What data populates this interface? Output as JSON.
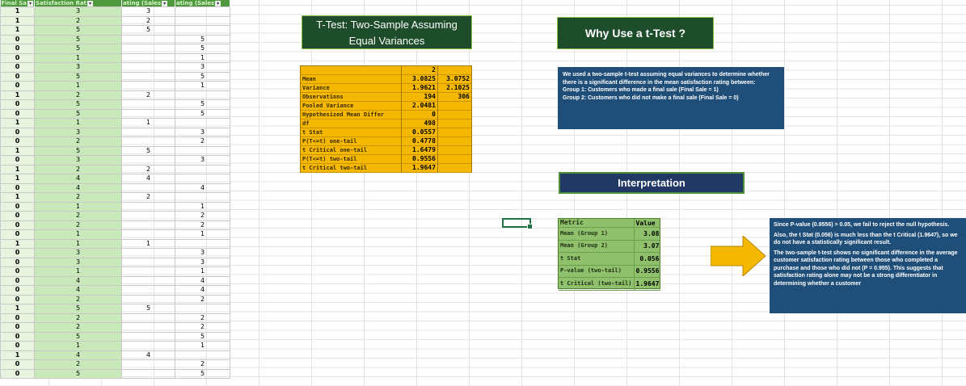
{
  "table": {
    "headers": [
      "Final Sa",
      "Satisfaction Rat",
      "ating (Sales",
      "ating (Sales"
    ],
    "rows": [
      [
        "1",
        "3",
        "3",
        ""
      ],
      [
        "1",
        "2",
        "2",
        ""
      ],
      [
        "1",
        "5",
        "5",
        ""
      ],
      [
        "0",
        "5",
        "",
        "5"
      ],
      [
        "0",
        "5",
        "",
        "5"
      ],
      [
        "0",
        "1",
        "",
        "1"
      ],
      [
        "0",
        "3",
        "",
        "3"
      ],
      [
        "0",
        "5",
        "",
        "5"
      ],
      [
        "0",
        "1",
        "",
        "1"
      ],
      [
        "1",
        "2",
        "2",
        ""
      ],
      [
        "0",
        "5",
        "",
        "5"
      ],
      [
        "0",
        "5",
        "",
        "5"
      ],
      [
        "1",
        "1",
        "1",
        ""
      ],
      [
        "0",
        "3",
        "",
        "3"
      ],
      [
        "0",
        "2",
        "",
        "2"
      ],
      [
        "1",
        "5",
        "5",
        ""
      ],
      [
        "0",
        "3",
        "",
        "3"
      ],
      [
        "1",
        "2",
        "2",
        ""
      ],
      [
        "1",
        "4",
        "4",
        ""
      ],
      [
        "0",
        "4",
        "",
        "4"
      ],
      [
        "1",
        "2",
        "2",
        ""
      ],
      [
        "0",
        "1",
        "",
        "1"
      ],
      [
        "0",
        "2",
        "",
        "2"
      ],
      [
        "0",
        "2",
        "",
        "2"
      ],
      [
        "0",
        "1",
        "",
        "1"
      ],
      [
        "1",
        "1",
        "1",
        ""
      ],
      [
        "0",
        "3",
        "",
        "3"
      ],
      [
        "0",
        "3",
        "",
        "3"
      ],
      [
        "0",
        "1",
        "",
        "1"
      ],
      [
        "0",
        "4",
        "",
        "4"
      ],
      [
        "0",
        "4",
        "",
        "4"
      ],
      [
        "0",
        "2",
        "",
        "2"
      ],
      [
        "1",
        "5",
        "5",
        ""
      ],
      [
        "0",
        "2",
        "",
        "2"
      ],
      [
        "0",
        "2",
        "",
        "2"
      ],
      [
        "0",
        "5",
        "",
        "5"
      ],
      [
        "0",
        "1",
        "",
        "1"
      ],
      [
        "1",
        "4",
        "4",
        ""
      ],
      [
        "0",
        "2",
        "",
        "2"
      ],
      [
        "0",
        "5",
        "",
        "5"
      ]
    ]
  },
  "ttest": {
    "title": "T-Test: Two-Sample Assuming Equal Variances",
    "header_v1": "2",
    "rows": [
      {
        "label": "Mean",
        "v1": "3.0825",
        "v2": "3.0752"
      },
      {
        "label": "Variance",
        "v1": "1.9621",
        "v2": "2.1025"
      },
      {
        "label": "Observations",
        "v1": "194",
        "v2": "306"
      },
      {
        "label": "Pooled Variance",
        "v1": "2.0481",
        "v2": ""
      },
      {
        "label": "Hypothesized Mean Differ",
        "v1": "0",
        "v2": ""
      },
      {
        "label": "df",
        "v1": "498",
        "v2": ""
      },
      {
        "label": "t Stat",
        "v1": "0.0557",
        "v2": ""
      },
      {
        "label": "P(T<=t) one-tail",
        "v1": "0.4778",
        "v2": ""
      },
      {
        "label": "t Critical one-tail",
        "v1": "1.6479",
        "v2": ""
      },
      {
        "label": "P(T<=t) two-tail",
        "v1": "0.9556",
        "v2": ""
      },
      {
        "label": "t Critical two-tail",
        "v1": "1.9647",
        "v2": ""
      }
    ]
  },
  "why": {
    "title": "Why Use a t-Test ?",
    "text1": "We used a two-sample t-test assuming equal variances to determine whether there is a significant difference in the mean satisfaction rating between:",
    "text2": "Group 1: Customers who made a final sale (Final Sale = 1)",
    "text3": "Group 2: Customers who did not make a final sale (Final Sale = 0)"
  },
  "interpretation": {
    "title": "Interpretation",
    "metric_header": "Metric",
    "value_header": "Value",
    "metrics": [
      {
        "label": "Mean (Group 1)",
        "value": "3.08"
      },
      {
        "label": "Mean (Group 2)",
        "value": "3.07"
      },
      {
        "label": "t Stat",
        "value": "0.056"
      },
      {
        "label": "P-value (two-tail)",
        "value": "0.9556"
      },
      {
        "label": "t Critical (two-tail)",
        "value": "1.9647"
      }
    ],
    "para1": "Since P-value (0.9556) > 0.05, we fail to reject the null hypothesis.",
    "para2": "Also, the t Stat (0.056) is much less than the t Critical (1.9647), so we do not have a statistically significant result.",
    "para3": "The two-sample t-test shows no significant difference in the average customer satisfaction rating between those who completed a purchase and those who did not (P = 0.955). This suggests that satisfaction rating alone may not be a strong differentiator in determining whether a customer"
  },
  "colors": {
    "dark_green": "#1e4d2b",
    "navy": "#1f4e79",
    "gold": "#f5b800",
    "arrow": "#f5b800"
  }
}
